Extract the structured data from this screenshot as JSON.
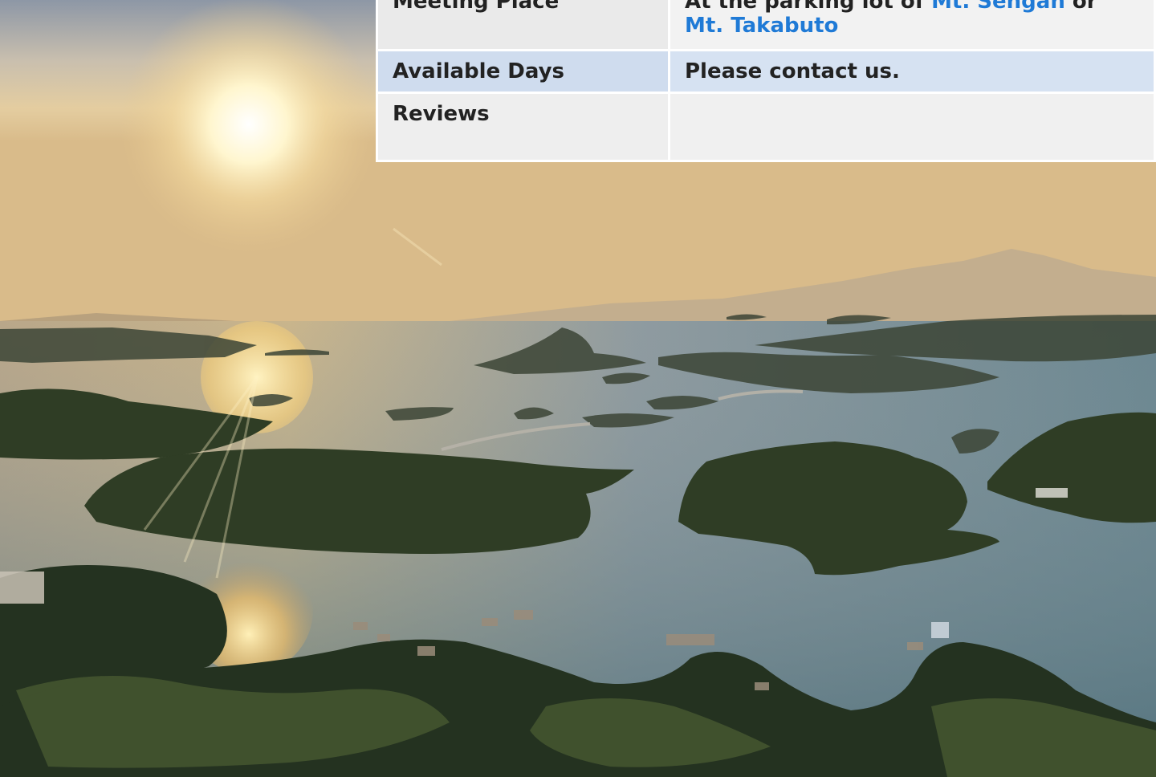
{
  "info_table": {
    "meeting": {
      "label": "Meeting Place",
      "prefix": "At the parking lot of ",
      "link1": "Mt. Sengan",
      "middle": " or ",
      "link2": "Mt. Takabuto"
    },
    "days": {
      "label": "Available Days",
      "value": "Please contact us."
    },
    "reviews": {
      "label": "Reviews",
      "value": ""
    }
  },
  "colors": {
    "link": "#1f7ad6",
    "row_highlight": "#d6e2f2"
  }
}
